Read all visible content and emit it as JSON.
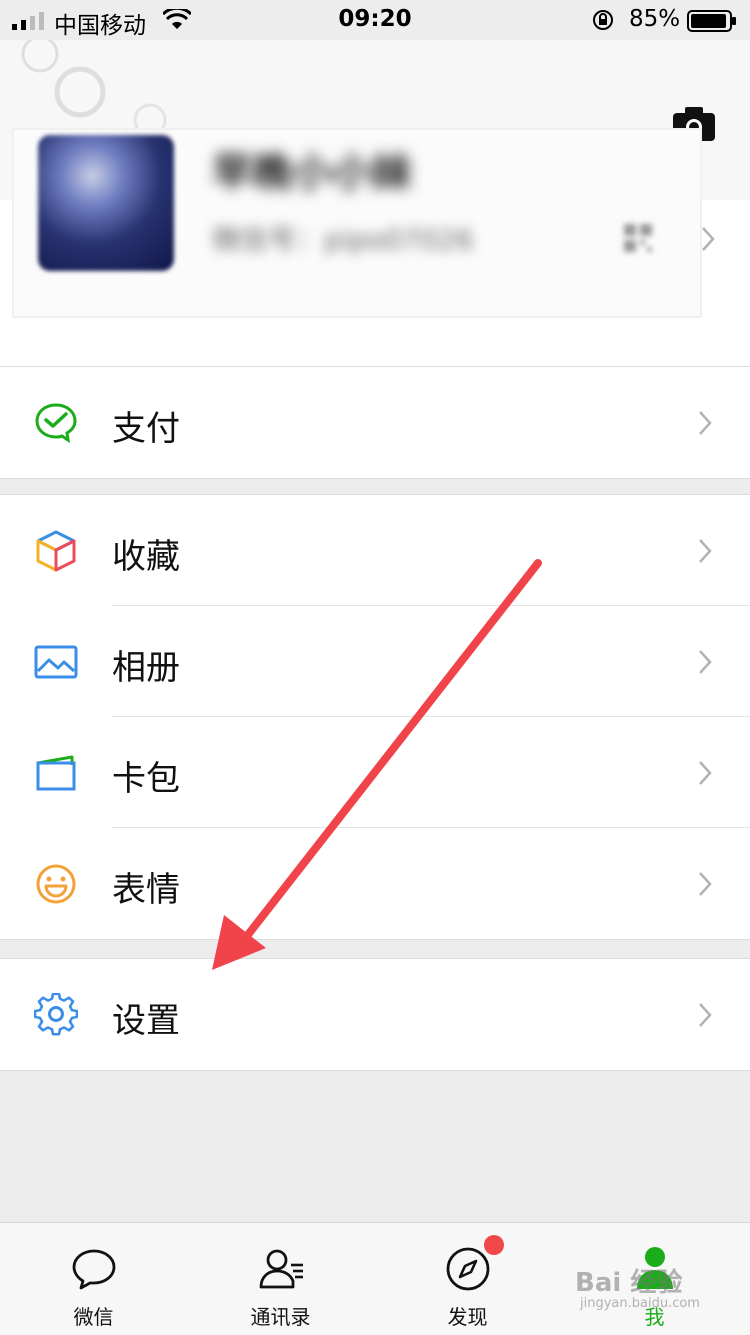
{
  "status_bar": {
    "carrier": "中国移动",
    "time": "09:20",
    "battery": "85%"
  },
  "profile": {
    "nickname": "早晚小小妹",
    "wechat_id": "微信号：pipo07026"
  },
  "menu_groups": [
    {
      "items": [
        {
          "label": "支付",
          "icon": "wechat-pay-icon"
        }
      ]
    },
    {
      "items": [
        {
          "label": "收藏",
          "icon": "favorites-cube-icon"
        },
        {
          "label": "相册",
          "icon": "album-icon"
        },
        {
          "label": "卡包",
          "icon": "card-wallet-icon"
        },
        {
          "label": "表情",
          "icon": "emoji-smile-icon"
        }
      ]
    },
    {
      "items": [
        {
          "label": "设置",
          "icon": "gear-icon"
        }
      ]
    }
  ],
  "tabbar": {
    "tabs": [
      {
        "label": "微信",
        "icon": "chat-bubble-icon"
      },
      {
        "label": "通讯录",
        "icon": "contacts-icon"
      },
      {
        "label": "发现",
        "icon": "compass-icon"
      },
      {
        "label": "我",
        "icon": "person-icon"
      }
    ],
    "active_index": 3
  },
  "watermark": {
    "text": "Bai 经验",
    "sub": "jingyan.baidu.com"
  },
  "colors": {
    "accent_green": "#1aad19",
    "annotation_arrow": "#f0444a",
    "badge": "#f04848"
  }
}
